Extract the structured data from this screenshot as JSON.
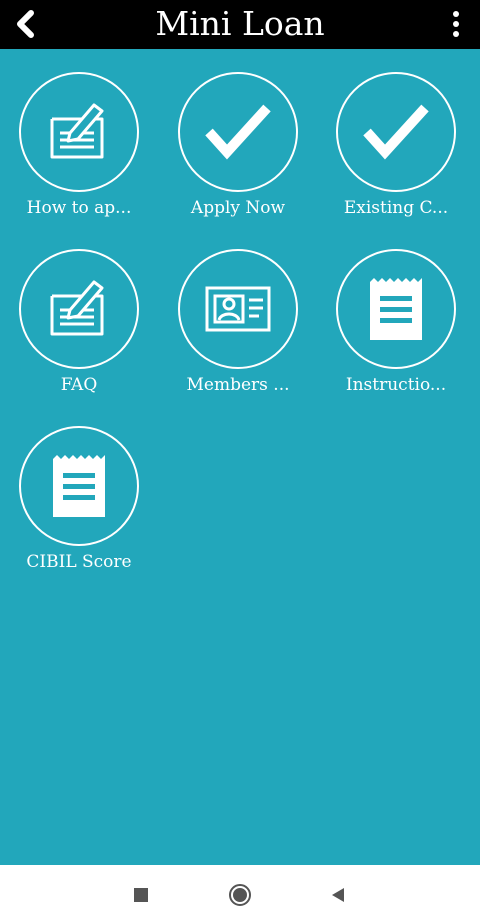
{
  "app": {
    "title": "Mini Loan"
  },
  "appbar": {
    "back_icon": "chevron-left-icon",
    "menu_icon": "more-vertical-icon"
  },
  "tiles": [
    {
      "label": "How to ap...",
      "icon": "edit-document-icon"
    },
    {
      "label": "Apply Now",
      "icon": "checkmark-icon"
    },
    {
      "label": "Existing C...",
      "icon": "checkmark-icon"
    },
    {
      "label": "FAQ",
      "icon": "edit-document-icon"
    },
    {
      "label": "Members ...",
      "icon": "id-card-icon"
    },
    {
      "label": "Instructio...",
      "icon": "notepad-icon"
    },
    {
      "label": "CIBIL Score",
      "icon": "notepad-icon"
    }
  ],
  "navigation": {
    "recents_icon": "square-icon",
    "home_icon": "circle-icon",
    "back_icon": "triangle-back-icon"
  },
  "colors": {
    "background": "#22a7bb",
    "appbar": "#000000",
    "foreground": "#ffffff",
    "navbar": "#ffffff"
  }
}
